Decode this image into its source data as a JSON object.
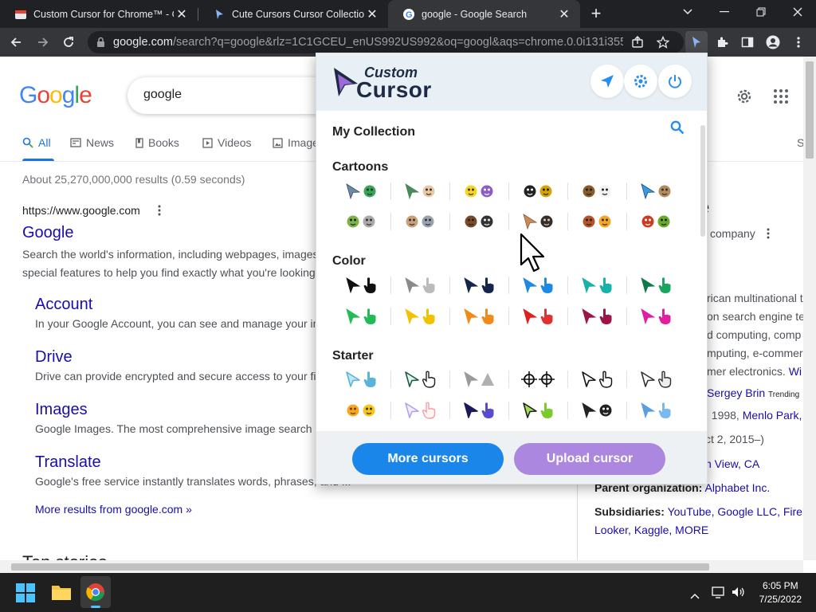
{
  "browser": {
    "tabs": [
      {
        "title": "Custom Cursor for Chrome™ - Ch",
        "active": false
      },
      {
        "title": "Cute Cursors Cursor Collection -",
        "active": false
      },
      {
        "title": "google - Google Search",
        "active": true
      }
    ],
    "url_host": "google.com",
    "url_rest": "/search?q=google&rlz=1C1GCEU_enUS992US992&oq=googl&aqs=chrome.0.0i131i355i4..."
  },
  "google": {
    "query": "google",
    "tabs": [
      "All",
      "News",
      "Books",
      "Videos",
      "Image"
    ],
    "tab_right_letter": "S",
    "stats": "About 25,270,000,000 results (0.59 seconds)",
    "breadcrumb": "https://www.google.com",
    "main_result": {
      "title": "Google",
      "snippet1": "Search the world's information, including webpages, images",
      "snippet2": "special features to help you find exactly what you're looking"
    },
    "sitelinks": [
      {
        "title": "Account",
        "snippet": "In your Google Account, you can see and manage your in"
      },
      {
        "title": "Drive",
        "snippet": "Drive can provide encrypted and secure access to your fi"
      },
      {
        "title": "Images",
        "snippet": "Google Images. The most comprehensive image search"
      },
      {
        "title": "Translate",
        "snippet": "Google's free service instantly translates words, phrases, and ..."
      }
    ],
    "more_results": "More results from google.com »",
    "top_stories": "Top stories"
  },
  "knowledge_panel": {
    "title_tail": "e",
    "subtitle_tail": "company",
    "desc": [
      "rican multinational t",
      "on search engine te",
      "d computing, comp",
      "mputing, e-commerc",
      "mer electronics."
    ],
    "desc_link": "Wi",
    "founders_link": "Sergey Brin",
    "founders_more": "Trending",
    "founded_date": ", 1998,",
    "founded_place": "Menlo Park,",
    "founded_2": "ct 2, 2015–)",
    "hq": "n View, CA",
    "parent_label": "Parent organization:",
    "parent_value": "Alphabet Inc.",
    "subs_label": "Subsidiaries:",
    "subs_values": "YouTube, Google LLC, Fireb",
    "subs_line2": "Looker, Kaggle, MORE"
  },
  "extension": {
    "logo_line1": "Custom",
    "logo_line2": "Cursor",
    "my_collection": "My Collection",
    "categories": [
      "Cartoons",
      "Color",
      "Starter"
    ],
    "more_button": "More cursors",
    "upload_button": "Upload cursor",
    "colors": {
      "more_btn": "#1a86ea",
      "upload_btn": "#ab87e0"
    },
    "color_pairs": [
      [
        "#111111",
        "#111111"
      ],
      [
        "#8a8a8a",
        "#bbbbbb"
      ],
      [
        "#14264a",
        "#14264a"
      ],
      [
        "#1e88e5",
        "#1e88e5"
      ],
      [
        "#17b3a8",
        "#17b3a8"
      ],
      [
        "#0f7a48",
        "#1aa55f"
      ],
      [
        "#22bb55",
        "#22bb55"
      ],
      [
        "#f2c200",
        "#f2c200"
      ],
      [
        "#f08a18",
        "#f08a18"
      ],
      [
        "#e02020",
        "#e03030"
      ],
      [
        "#9b1548",
        "#9b1548"
      ],
      [
        "#e020a0",
        "#e020a0"
      ]
    ]
  },
  "taskbar": {
    "time": "6:05 PM",
    "date": "7/25/2022"
  }
}
